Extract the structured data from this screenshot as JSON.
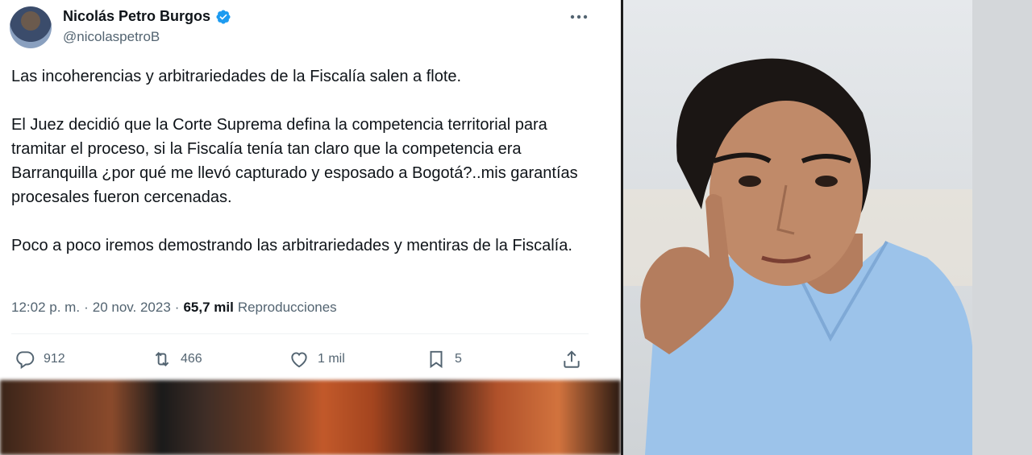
{
  "tweet": {
    "author_name": "Nicolás Petro Burgos",
    "handle": "@nicolaspetroB",
    "paragraphs": [
      "Las incoherencias y arbitrariedades de la Fiscalía salen a flote.",
      "El Juez decidió que la Corte Suprema defina la competencia territorial para tramitar el proceso, si la Fiscalía tenía tan claro que la competencia era Barranquilla ¿por qué me llevó capturado y esposado a Bogotá?..mis garantías procesales fueron cercenadas.",
      "Poco a poco iremos demostrando las arbitrariedades y mentiras de la Fiscalía."
    ],
    "time": "12:02 p. m.",
    "separator": "·",
    "date": "20 nov. 2023",
    "views_count": "65,7 mil",
    "views_label": "Reproducciones"
  },
  "actions": {
    "replies": "912",
    "reposts": "466",
    "likes": "1 mil",
    "bookmarks": "5"
  },
  "icons": {
    "verified": "verified-badge-icon",
    "more": "more-icon",
    "reply": "reply-icon",
    "repost": "repost-icon",
    "like": "heart-icon",
    "bookmark": "bookmark-icon",
    "share": "share-icon"
  },
  "colors": {
    "verified_blue": "#1d9bf0",
    "text_primary": "#0f1419",
    "text_secondary": "#536471",
    "shirt_blue": "#9cc3ea"
  }
}
